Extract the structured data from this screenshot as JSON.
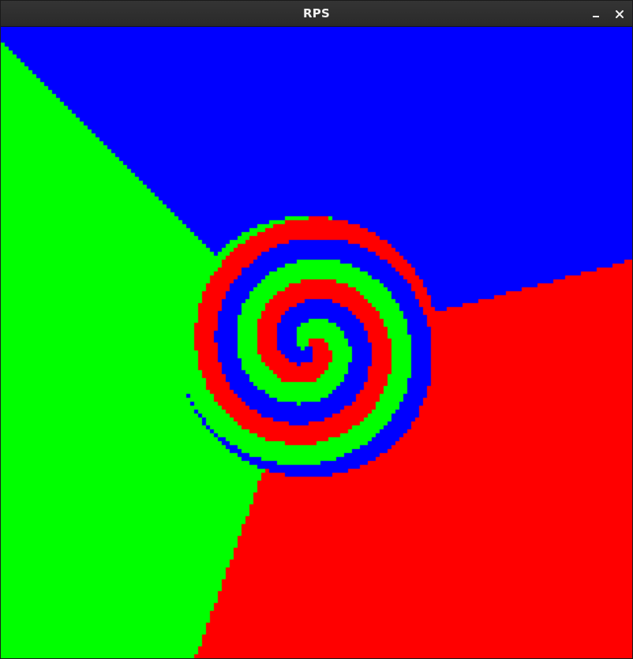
{
  "window": {
    "title": "RPS",
    "minimize_icon": "minimize-icon",
    "close_icon": "close-icon"
  },
  "simulation": {
    "colors": {
      "red": "#ff0000",
      "green": "#00ff00",
      "blue": "#0000ff"
    }
  }
}
